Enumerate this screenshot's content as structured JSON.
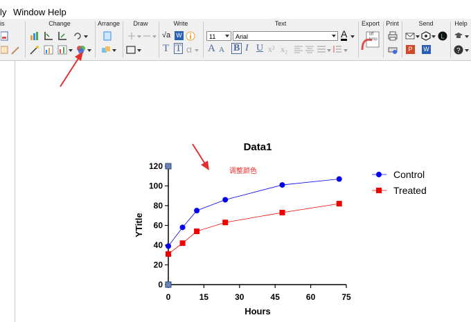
{
  "menu": {
    "partial": "ly",
    "window": "Window",
    "help": "Help"
  },
  "ribbon": {
    "groups": {
      "analysis_partial": "is",
      "change": "Change",
      "arrange": "Arrange",
      "draw": "Draw",
      "write": "Write",
      "text": "Text",
      "export": "Export",
      "print": "Print",
      "send": "Send",
      "help": "Help"
    },
    "font_size": "11",
    "font_name": "Arial",
    "write_badge": "W",
    "sqrt_label": "√a",
    "alpha": "α",
    "export_icon_text": "tiff bmp",
    "ppt": "P",
    "word": "W",
    "text_buttons": {
      "bold": "B",
      "italic": "I",
      "underline": "U",
      "sup": "x²",
      "sub": "x₂",
      "big_a": "A",
      "small_a": "A",
      "color_a": "A"
    },
    "write_t1": "T",
    "write_t2": "T"
  },
  "annotation": "调整颜色",
  "colors": {
    "control": "#0000ee",
    "treated": "#ee0000",
    "annotation": "#e23030",
    "arrow": "#e23030"
  },
  "chart_data": {
    "type": "line",
    "title": "Data1",
    "xlabel": "Hours",
    "ylabel": "YTitle",
    "xlim": [
      0,
      75
    ],
    "ylim": [
      0,
      120
    ],
    "xticks": [
      0,
      15,
      30,
      45,
      60,
      75
    ],
    "yticks": [
      0,
      20,
      40,
      60,
      80,
      100,
      120
    ],
    "grid": false,
    "legend": "right",
    "series": [
      {
        "name": "Control",
        "x": [
          0,
          6,
          12,
          24,
          48,
          72
        ],
        "y": [
          39,
          58,
          75,
          86,
          101,
          107
        ],
        "marker": "circle"
      },
      {
        "name": "Treated",
        "x": [
          0,
          6,
          12,
          24,
          48,
          72
        ],
        "y": [
          31,
          42,
          54,
          63,
          73,
          82
        ],
        "marker": "square"
      }
    ]
  }
}
